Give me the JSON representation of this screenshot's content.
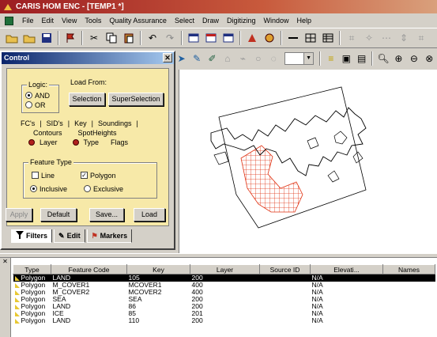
{
  "window": {
    "title": "CARIS HOM ENC - [TEMP1 *]"
  },
  "menu": [
    "File",
    "Edit",
    "View",
    "Tools",
    "Quality Assurance",
    "Select",
    "Draw",
    "Digitizing",
    "Window",
    "Help"
  ],
  "control": {
    "title": "Control",
    "logic_label": "Logic:",
    "logic_and": "AND",
    "logic_or": "OR",
    "load_from_label": "Load From:",
    "selection_button": "Selection",
    "superselection_button": "SuperSelection",
    "tabs_row1": [
      "FC's",
      "SID's",
      "Key",
      "Soundings"
    ],
    "tabs_row2": [
      "Contours",
      "SpotHeights"
    ],
    "tabs_row3": [
      "Layer",
      "Type",
      "Flags"
    ],
    "feature_type_label": "Feature Type",
    "line_label": "Line",
    "polygon_label": "Polygon",
    "inclusive_label": "Inclusive",
    "exclusive_label": "Exclusive",
    "apply_button": "Apply",
    "default_button": "Default",
    "save_button": "Save...",
    "load_button": "Load",
    "bottom_tabs": [
      "Filters",
      "Edit",
      "Markers"
    ]
  },
  "table": {
    "columns": [
      "Type",
      "Feature Code",
      "Key",
      "Layer",
      "Source ID",
      "Elevati...",
      "Names"
    ],
    "rows": [
      [
        "Polygon",
        "LAND",
        "105",
        "200",
        "",
        "N/A",
        ""
      ],
      [
        "Polygon",
        "M_COVER1",
        "MCOVER1",
        "400",
        "",
        "N/A",
        ""
      ],
      [
        "Polygon",
        "M_COVER2",
        "MCOVER2",
        "400",
        "",
        "N/A",
        ""
      ],
      [
        "Polygon",
        "SEA",
        "SEA",
        "200",
        "",
        "N/A",
        ""
      ],
      [
        "Polygon",
        "LAND",
        "86",
        "200",
        "",
        "N/A",
        ""
      ],
      [
        "Polygon",
        "ICE",
        "85",
        "201",
        "",
        "N/A",
        ""
      ],
      [
        "Polygon",
        "LAND",
        "110",
        "200",
        "",
        "N/A",
        ""
      ]
    ],
    "selected_row": 0
  },
  "colors": {
    "hatch": "#e03010",
    "title_bar": "#9c1c22",
    "panel": "#f7e9a8"
  }
}
